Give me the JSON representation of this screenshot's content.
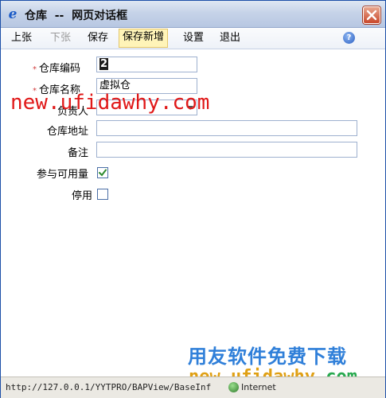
{
  "window": {
    "title": "仓库  --  网页对话框"
  },
  "toolbar": {
    "prev_label": "上张",
    "next_label": "下张",
    "save_label": "保存",
    "save_new_label": "保存新增",
    "settings_label": "设置",
    "exit_label": "退出"
  },
  "form": {
    "required_mark": "*",
    "code_label": "仓库编码",
    "code_value": "2",
    "name_label": "仓库名称",
    "name_value": "虚拟仓",
    "manager_label": "负责人",
    "manager_value": "",
    "address_label": "仓库地址",
    "address_value": "",
    "note_label": "备注",
    "note_value": "",
    "available_label": "参与可用量",
    "available_checked": true,
    "disabled_label": "停用",
    "disabled_checked": false
  },
  "watermarks": {
    "url_top": "new.ufidawhy.com",
    "cn_text": "用友软件免费下载",
    "url_bottom_a": "new.",
    "url_bottom_b": "ufidawhy",
    "url_bottom_c": ".com"
  },
  "status": {
    "url": "http://127.0.0.1/YYTPRO/BAPView/BaseInf",
    "zone": "Internet"
  },
  "icons": {
    "window_icon": "ie-icon",
    "close": "close-icon",
    "help": "help-icon",
    "dropdown": "chevron-down-icon",
    "status_zone": "globe-icon"
  }
}
